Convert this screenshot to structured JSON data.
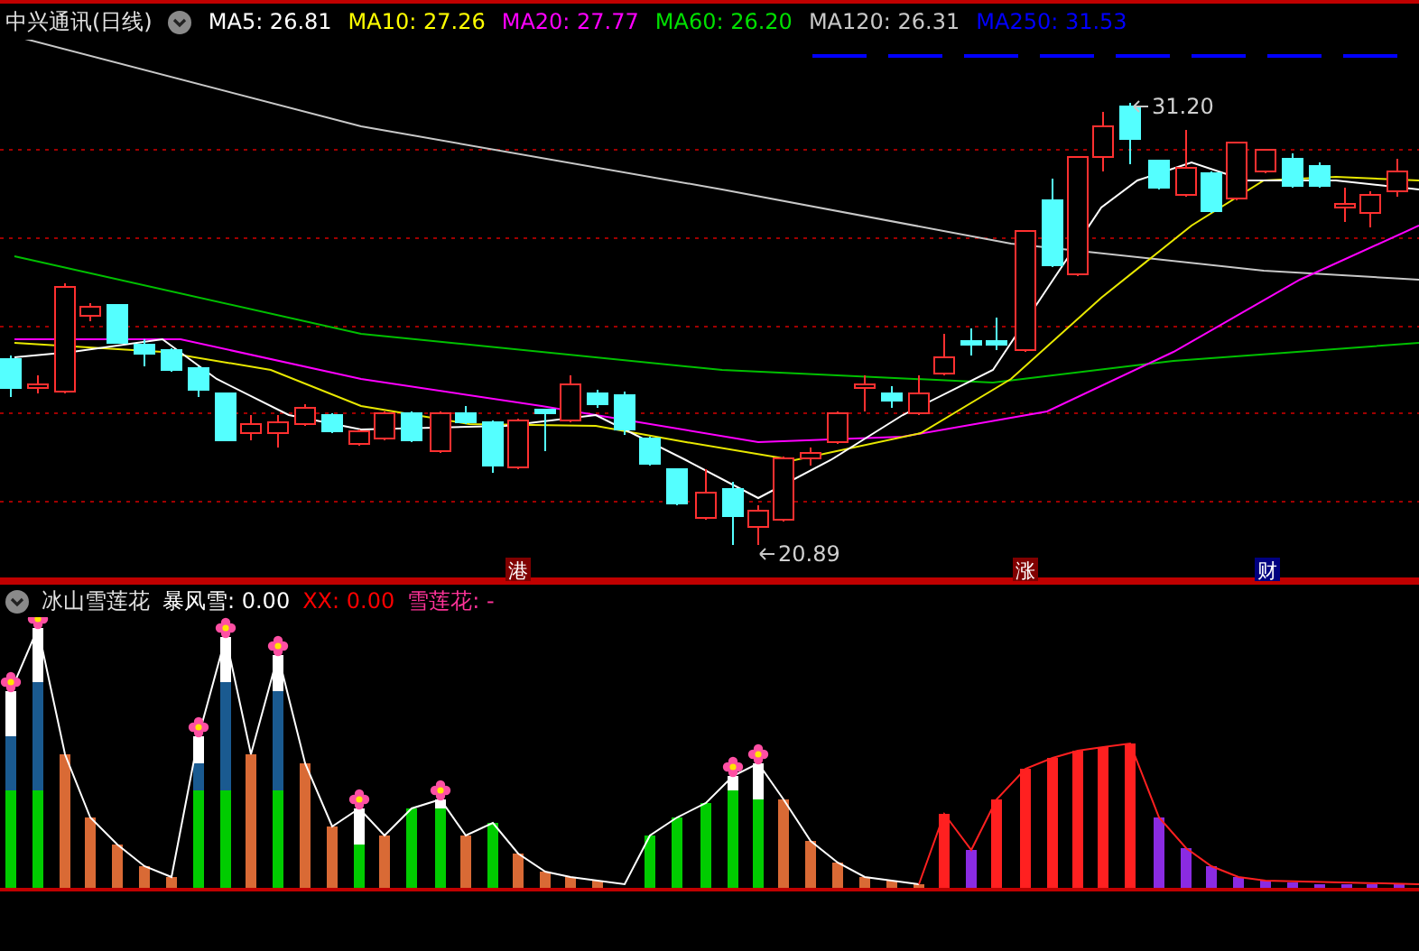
{
  "chart_header": {
    "title": "中兴通讯(日线)",
    "moving_averages": [
      {
        "label": "MA5: 26.81",
        "color": "#ffffff"
      },
      {
        "label": "MA10: 27.26",
        "color": "#ffff00"
      },
      {
        "label": "MA20: 27.77",
        "color": "#ff00ff"
      },
      {
        "label": "MA60: 26.20",
        "color": "#00e000"
      },
      {
        "label": "MA120: 26.31",
        "color": "#c8c8c8"
      },
      {
        "label": "MA250: 31.53",
        "color": "#0000ff"
      }
    ]
  },
  "price_chart": {
    "high_label": "31.20",
    "low_label": "20.89",
    "event_tags": [
      {
        "text": "港",
        "color": "#800000"
      },
      {
        "text": "涨",
        "color": "#800000"
      },
      {
        "text": "财",
        "color": "#000080"
      }
    ]
  },
  "indicator_header": {
    "title": "冰山雪莲花",
    "values": [
      {
        "label": "暴风雪: 0.00",
        "color": "#ffffff"
      },
      {
        "label": "XX: 0.00",
        "color": "#ff0000"
      },
      {
        "label": "雪莲花: -",
        "color": "#ff3399"
      }
    ]
  }
}
